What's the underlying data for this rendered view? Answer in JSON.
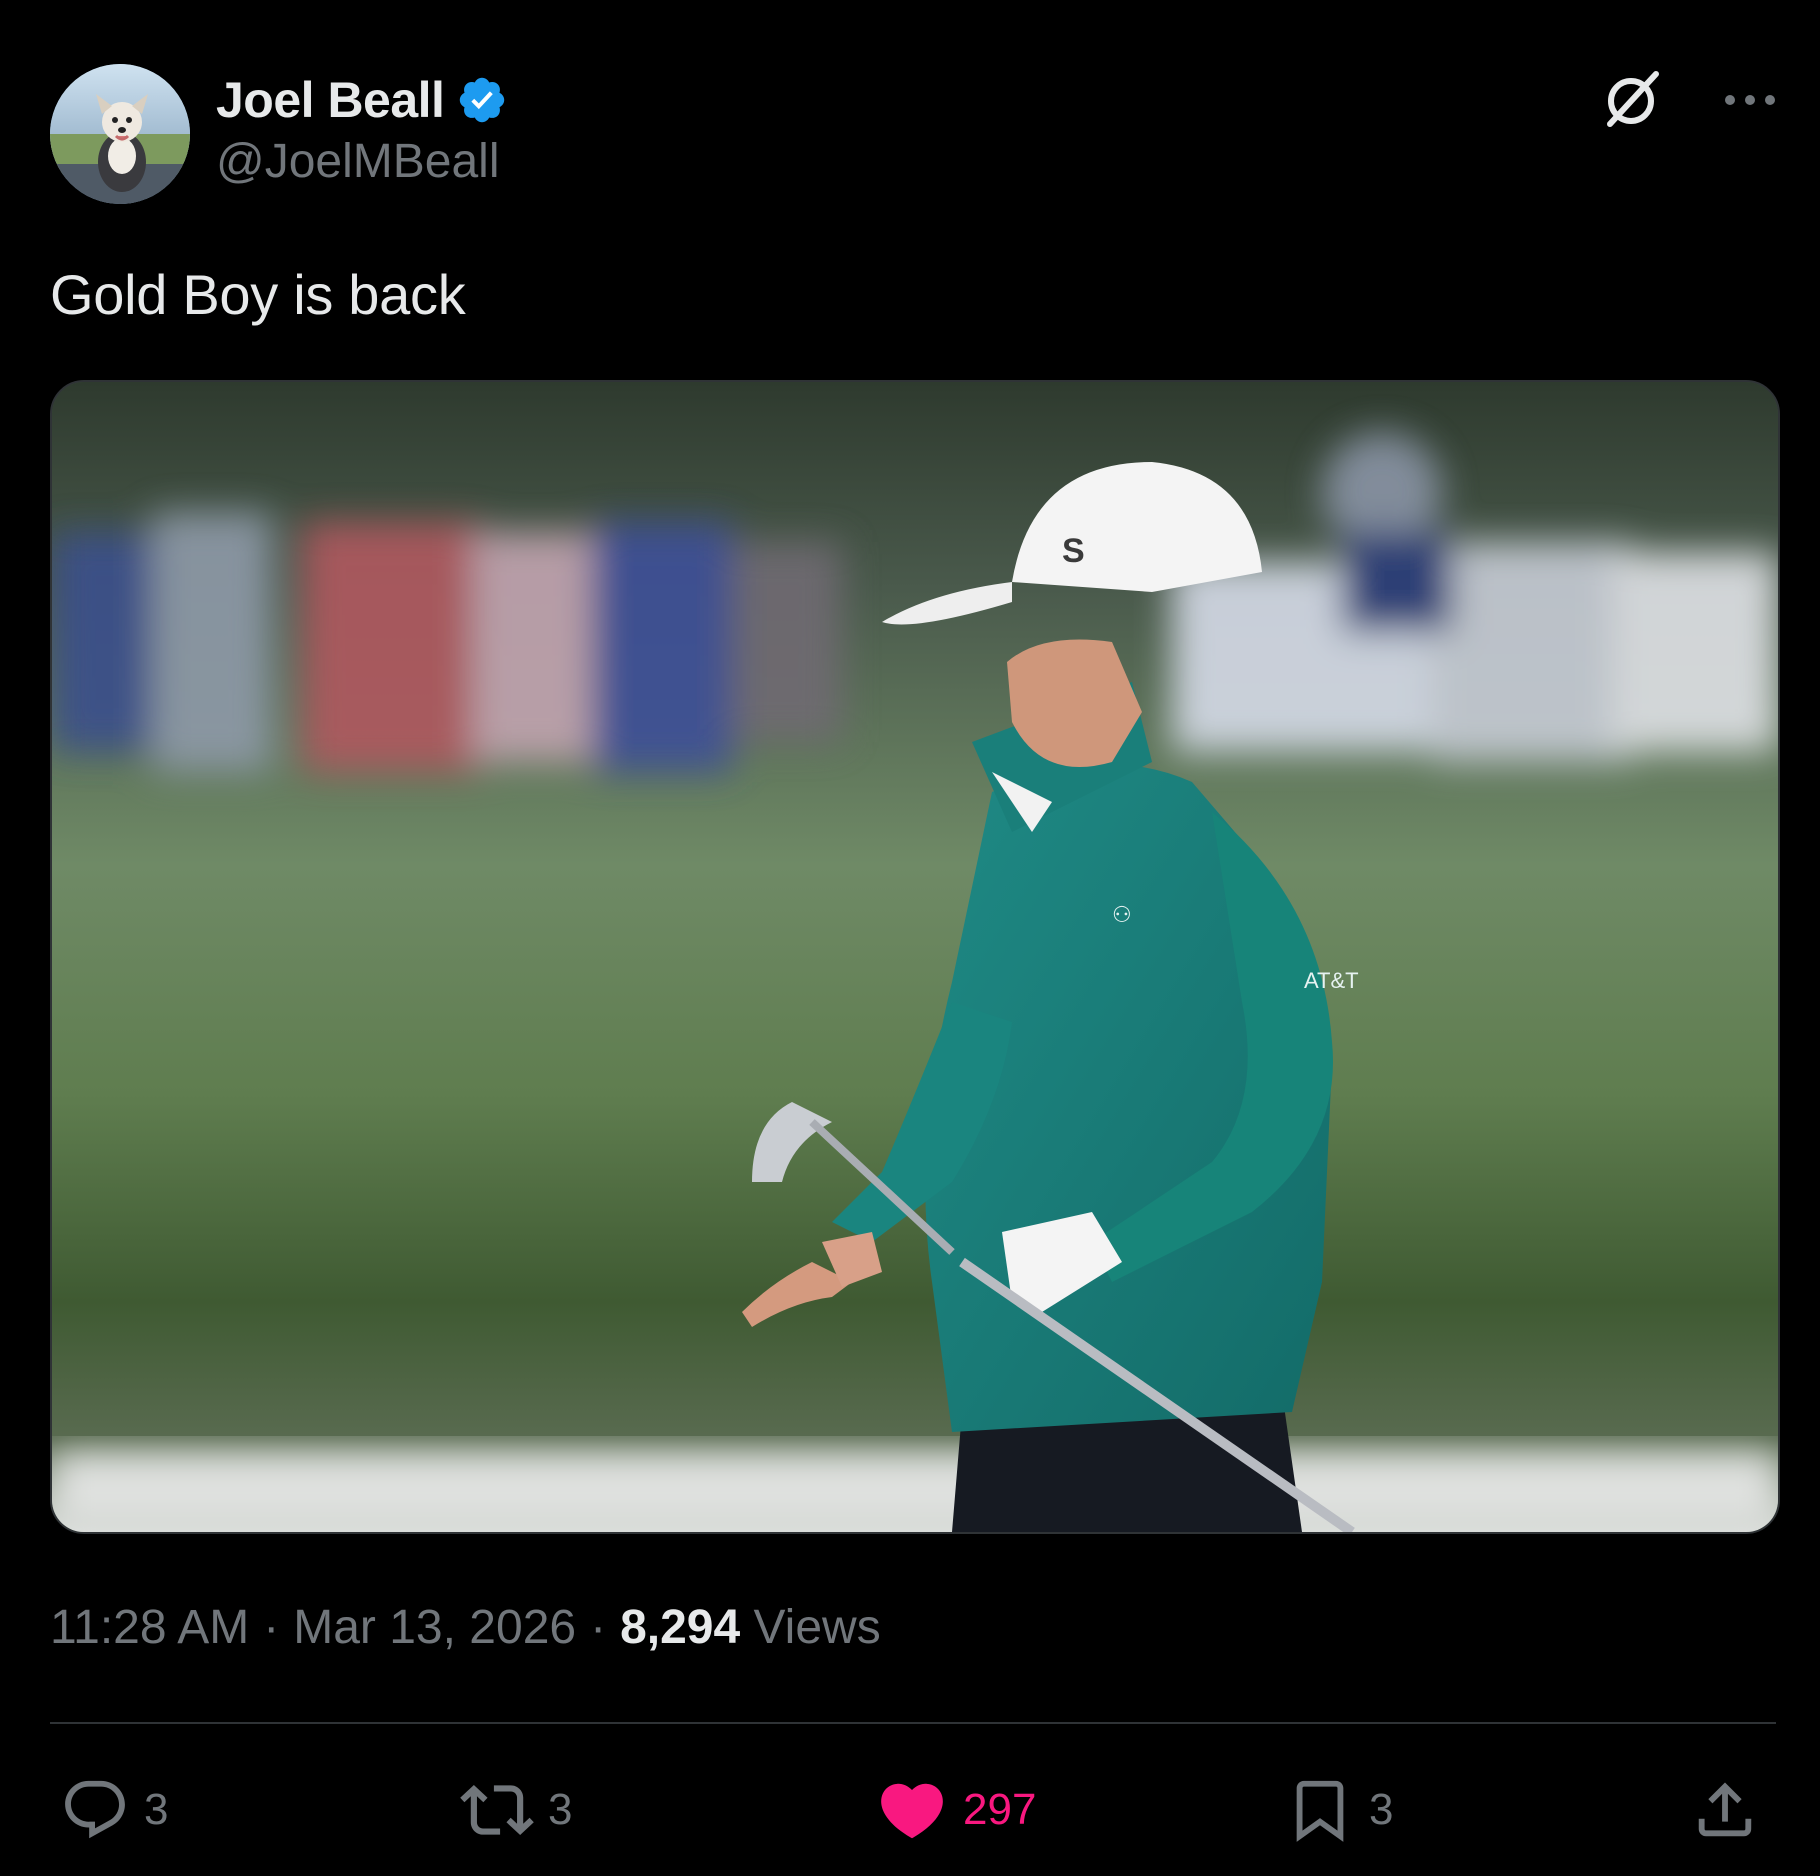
{
  "author": {
    "display_name": "Joel Beall",
    "handle": "@JoelMBeall",
    "verified": true,
    "avatar_icon": "dog-avatar",
    "verified_color": "#1d9bf0"
  },
  "tweet": {
    "text": "Gold Boy is back",
    "media_alt": "golfer-photo"
  },
  "meta": {
    "time": "11:28 AM",
    "date": "Mar 13, 2026",
    "views_count": "8,294",
    "views_label": "Views",
    "separator": "·"
  },
  "actions": {
    "replies": "3",
    "reposts": "3",
    "likes": "297",
    "bookmarks": "3",
    "like_color": "#f91880",
    "icons": [
      "reply-icon",
      "repost-icon",
      "heart-icon",
      "bookmark-icon",
      "share-icon"
    ]
  },
  "header_icons": [
    "grok-icon",
    "more-icon"
  ]
}
